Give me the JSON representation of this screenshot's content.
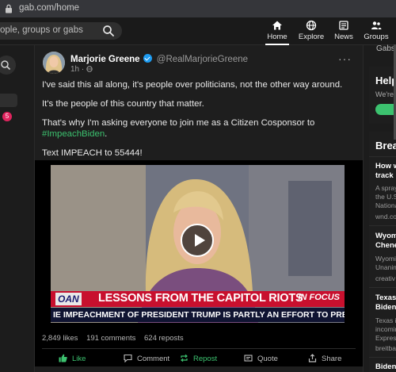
{
  "browser": {
    "url": "gab.com/home"
  },
  "topnav": {
    "search_placeholder": "ople, groups or gabs",
    "items": [
      {
        "label": "Home",
        "icon": "home-icon",
        "active": true
      },
      {
        "label": "Explore",
        "icon": "globe-icon"
      },
      {
        "label": "News",
        "icon": "news-icon"
      },
      {
        "label": "Groups",
        "icon": "groups-icon"
      }
    ]
  },
  "left_rail": {
    "badge": "5"
  },
  "post": {
    "author_name": "Marjorie Greene",
    "author_handle": "@RealMarjorieGreene",
    "time": "1h ·",
    "more": "···",
    "paragraphs": [
      "I've said this all along, it's people over politicians, not the other way around.",
      "It's the people of this country that matter."
    ],
    "p3_prefix": "That's why I'm asking everyone to join me as a Citizen Cosponsor to ",
    "p3_hashtag": "#ImpeachBiden",
    "p3_suffix": ".",
    "p4": "Text IMPEACH to 55444!",
    "video": {
      "network": "OAN",
      "headline": "LESSONS FROM THE CAPITOL RIOTS",
      "segment": "IN FOCUS",
      "ticker": "IE IMPEACHMENT OF PRESIDENT TRUMP IS PARTLY AN EFFORT TO PREVENT HIM FROM RUNNING I"
    },
    "stats": {
      "likes": "2,849 likes",
      "comments": "191 comments",
      "reposts": "624 reposts"
    },
    "actions": {
      "like": "Like",
      "comment": "Comment",
      "repost": "Repost",
      "quote": "Quote",
      "share": "Share"
    }
  },
  "right": {
    "top_label": "Gabs",
    "help_title": "Help",
    "help_sub": "We're t",
    "breaking_title": "Break",
    "news": [
      {
        "title1": "How w",
        "title2": "track I",
        "sub": [
          "A spray",
          "the U.S",
          "Nationa"
        ],
        "source": "wnd.co"
      },
      {
        "title1": "Wyom",
        "title2": "Chene",
        "sub": [
          "Wyomi",
          "Unanim"
        ],
        "source": "creativ"
      },
      {
        "title1": "Texas",
        "title2": "Biden'",
        "sub": [
          "Texas is",
          "incomin",
          "Expres"
        ],
        "source": "breitba"
      },
      {
        "title1": "Biden",
        "title2": "",
        "sub": [],
        "source": ""
      }
    ]
  },
  "colors": {
    "accent_green": "#3cc26f",
    "verified_blue": "#1d9bf0",
    "badge_red": "#e0245e",
    "chyron_red": "#c8102e"
  }
}
